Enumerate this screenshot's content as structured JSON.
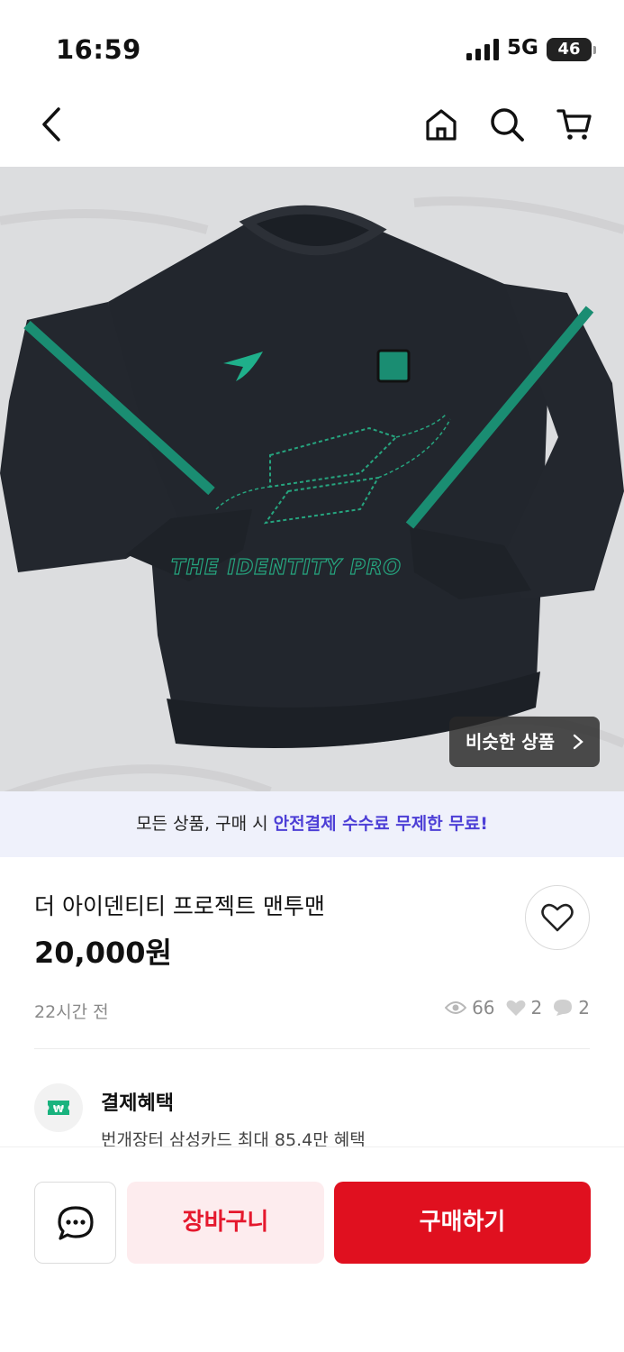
{
  "status_bar": {
    "time": "16:59",
    "network": "5G",
    "battery": "46"
  },
  "nav": {
    "back_icon": "chevron-left-icon",
    "home_icon": "home-icon",
    "search_icon": "search-icon",
    "cart_icon": "cart-icon"
  },
  "hero": {
    "print_text": "THE IDENTITY PRO",
    "similar_label": "비슷한 상품",
    "colors": {
      "garment": "#22262d",
      "stripe": "#1a8d72",
      "background": "#d9dadc"
    }
  },
  "promo": {
    "prefix": "모든 상품, 구매 시 ",
    "highlight": "안전결제 수수료 무제한 무료!"
  },
  "product": {
    "title": "더 아이덴티티 프로젝트 맨투맨",
    "price": "20,000원",
    "posted": "22시간 전",
    "views": "66",
    "likes": "2",
    "chats": "2"
  },
  "payment": {
    "title": "결제혜택",
    "description": "번개장터 삼성카드 최대 85.4만 혜택"
  },
  "actions": {
    "chat_icon": "chat-bubble-icon",
    "cart_label": "장바구니",
    "buy_label": "구매하기"
  },
  "colors": {
    "accent_red": "#e0101f",
    "promo_purple": "#4d3fd6"
  }
}
